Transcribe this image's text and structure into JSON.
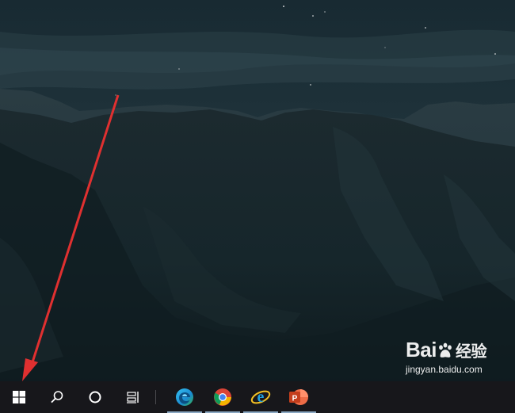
{
  "desktop": {
    "wallpaper": "mountain-night-landscape",
    "annotation": "red-arrow-pointing-to-start-button"
  },
  "watermark": {
    "logo_prefix": "Bai",
    "logo_chinese": "经验",
    "url": "jingyan.baidu.com"
  },
  "taskbar": {
    "background": "#17171b",
    "buttons": [
      {
        "name": "start-button",
        "icon": "windows-logo-icon"
      },
      {
        "name": "search-button",
        "icon": "search-icon"
      },
      {
        "name": "cortana-button",
        "icon": "cortana-circle-icon"
      },
      {
        "name": "task-view-button",
        "icon": "task-view-icon"
      }
    ],
    "apps": [
      {
        "name": "edge-app",
        "icon": "edge-icon",
        "color": "#1aa0d8"
      },
      {
        "name": "chrome-app",
        "icon": "chrome-icon",
        "color": "#4285f4"
      },
      {
        "name": "ie-app",
        "icon": "internet-explorer-icon",
        "color": "#1fa0e0"
      },
      {
        "name": "powerpoint-app",
        "icon": "powerpoint-icon",
        "color": "#d04423"
      }
    ]
  }
}
